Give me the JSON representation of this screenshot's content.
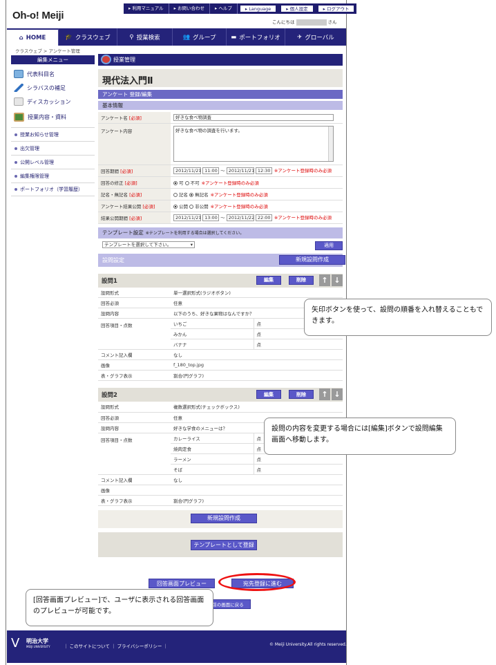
{
  "header": {
    "logo": "Oh-o! Meiji",
    "top_links": [
      "利用マニュアル",
      "お問い合わせ",
      "ヘルプ",
      "Language",
      "個人設定",
      "ログアウト"
    ],
    "greeting_prefix": "こんにちは",
    "greeting_suffix": "さん"
  },
  "nav": [
    "HOME",
    "クラスウェブ",
    "授業検索",
    "グループ",
    "ポートフォリオ",
    "グローバル"
  ],
  "breadcrumb": "クラスウェブ > アンケート管理",
  "sidebar": {
    "title": "編集メニュー",
    "items": [
      "代表科目名",
      "シラバスの補足",
      "ディスカッション",
      "授業内容・資料"
    ],
    "links": [
      "授業お知らせ管理",
      "出欠管理",
      "公開レベル管理",
      "編集権限管理",
      "ポートフォリオ（学習履歴）"
    ]
  },
  "main": {
    "header": "授業管理",
    "course": "現代法入門Ⅱ",
    "section": "アンケート  登録/編集",
    "basic": "基本情報",
    "required": "[必須]",
    "form": {
      "name_label": "アンケート名",
      "name_value": "好きな食べ物調査",
      "content_label": "アンケート内容",
      "content_value": "好きな食べ物の調査を行います。",
      "period_label": "回答期間",
      "period_start_date": "2012/11/21",
      "period_start_time": "11:00",
      "period_end_date": "2012/11/21",
      "period_end_time": "12:30",
      "tilde": "～",
      "note": "※アンケート登録時のみ必須",
      "modify_label": "回答の修正",
      "modify_options": [
        "可",
        "不可"
      ],
      "named_label": "記名・無記名",
      "named_options": [
        "記名",
        "無記名"
      ],
      "publish_label": "アンケート結果公開",
      "publish_options": [
        "公開",
        "非公開"
      ],
      "result_period_label": "結果公開期間",
      "result_start_date": "2012/11/21",
      "result_start_time": "13:00",
      "result_end_date": "2012/11/22",
      "result_end_time": "22:00"
    },
    "template": {
      "title": "テンプレート設定",
      "hint": "※テンプレートを利用する場合は選択してください。",
      "select": "テンプレートを選択して下さい。",
      "apply": "適用"
    },
    "question_settings": "設問設定",
    "new_question": "新規設問作成",
    "edit": "編集",
    "delete": "削除",
    "row_labels": {
      "format": "設問形式",
      "required": "回答必須",
      "content": "設問内容",
      "answers": "回答項目・点数",
      "comment": "コメント記入欄",
      "image": "画像",
      "graph": "表・グラフ表示"
    },
    "points": "点",
    "questions": [
      {
        "title": "設問1",
        "format": "単一選択形式(ラジオボタン)",
        "required": "任意",
        "content": "以下のうち、好きな果物はなんですか？",
        "answers": [
          "いちご",
          "みかん",
          "バナナ"
        ],
        "comment": "なし",
        "image": "f_180_top.jpg",
        "graph": "割合(円グラフ)"
      },
      {
        "title": "設問2",
        "format": "複数選択形式(チェックボックス)",
        "required": "任意",
        "content": "好きな学食のメニューは？",
        "answers": [
          "カレーライス",
          "焼肉定食",
          "ラーメン",
          "そば"
        ],
        "comment": "なし",
        "image": "",
        "graph": "割合(円グラフ)"
      }
    ],
    "save_template": "テンプレートとして登録",
    "preview": "回答画面プレビュー",
    "next": "宛先登録に進む",
    "back": "前の画面に戻る"
  },
  "footer": {
    "univ": "明治大学",
    "univ_en": "MEIJI UNIVERSITY",
    "links": "｜ このサイトについて ｜ プライバシーポリシー ｜",
    "copyright": "© Meiji University.All rights reserved."
  },
  "callouts": [
    "矢印ボタンを使って、設問の順番を入れ替えることもできます。",
    "設問の内容を変更する場合には[編集]ボタンで設問編集画面へ移動します。",
    "[回答画面プレビュー]で、ユーザに表示される回答画面のプレビューが可能です。"
  ]
}
